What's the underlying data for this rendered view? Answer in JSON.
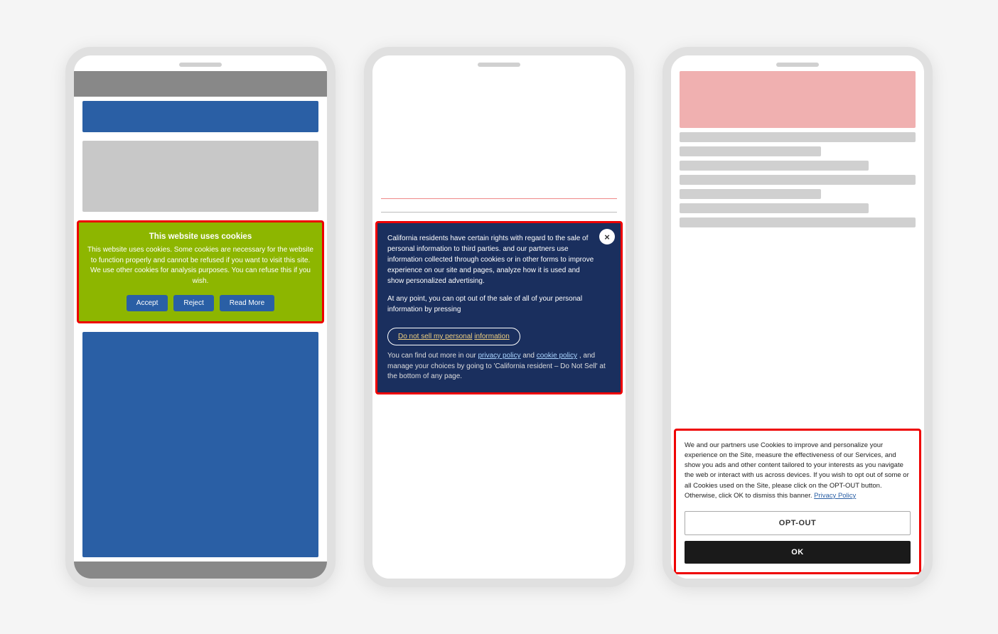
{
  "phone1": {
    "speaker": "",
    "cookie_banner": {
      "title": "This website uses cookies",
      "text": "This website uses cookies. Some cookies are necessary for the website to function properly and cannot be refused if you want to visit this site. We use other cookies for analysis purposes. You can refuse this if you wish.",
      "btn_accept": "Accept",
      "btn_reject": "Reject",
      "btn_read_more": "Read More"
    }
  },
  "phone2": {
    "speaker": "",
    "cookie_banner": {
      "close_icon": "×",
      "text1": "California residents have certain rights with regard to the sale of personal information to third parties.",
      "text2": "and our partners use information collected through cookies or in other forms to improve experience on our site and pages, analyze how it is used and show personalized advertising.",
      "text3": "At any point, you can opt out of the sale of all of your personal information by pressing",
      "opt_btn_label": "Do not sell my personal",
      "opt_btn_highlight": "information",
      "footer_text": "You can find out more in our",
      "privacy_link": "privacy policy",
      "and_text": "and",
      "cookie_link": "cookie policy",
      "footer_text2": ", and manage your choices by going to 'California resident – Do Not Sell' at the bottom of any page."
    }
  },
  "phone3": {
    "speaker": "",
    "cookie_banner": {
      "text": "We and our partners use Cookies to improve and personalize your experience on the Site, measure the effectiveness of our Services, and show you ads and other content tailored to your interests as you navigate the web or interact with us across devices. If you wish to opt out of some or all Cookies used on the Site, please click on the OPT-OUT button. Otherwise, click OK to dismiss this banner.",
      "privacy_link": "Privacy Policy",
      "btn_opt_out": "OPT-OUT",
      "btn_ok": "OK"
    }
  }
}
